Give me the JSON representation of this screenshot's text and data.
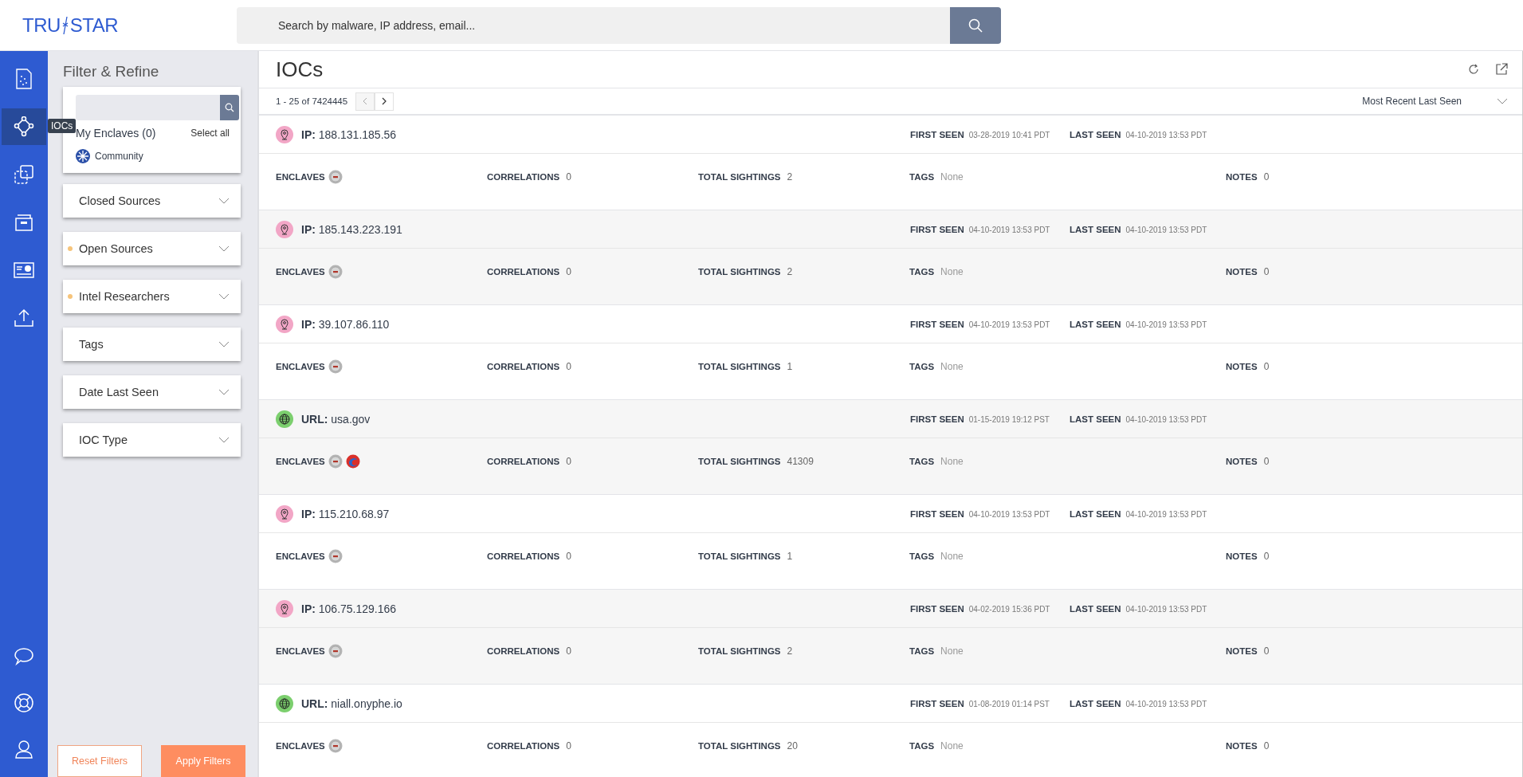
{
  "header": {
    "logo_left": "TRU",
    "logo_right": "STAR",
    "search": {
      "placeholder": "Search by malware, IP address, email..."
    }
  },
  "rail": {
    "items": [
      {
        "kind": "reports",
        "selected": false
      },
      {
        "kind": "network",
        "selected": true,
        "tooltip": "IOCs"
      },
      {
        "kind": "copy",
        "selected": false
      },
      {
        "kind": "archive",
        "selected": false
      },
      {
        "kind": "card",
        "selected": false
      },
      {
        "kind": "upload",
        "selected": false
      }
    ],
    "bottom": [
      {
        "kind": "chat"
      },
      {
        "kind": "help"
      },
      {
        "kind": "user"
      }
    ]
  },
  "filter": {
    "title": "Filter & Refine",
    "enclaves_label": "My Enclaves (0)",
    "select_all": "Select all",
    "community": "Community",
    "sections": [
      {
        "label": "Closed Sources",
        "indicator": false
      },
      {
        "label": "Open Sources",
        "indicator": true
      },
      {
        "label": "Intel Researchers",
        "indicator": true
      },
      {
        "label": "Tags",
        "indicator": false
      },
      {
        "label": "Date Last Seen",
        "indicator": false
      },
      {
        "label": "IOC Type",
        "indicator": false
      }
    ],
    "reset": "Reset Filters",
    "apply": "Apply Filters"
  },
  "main": {
    "title": "IOCs",
    "range": "1 - 25 of 7424445",
    "sort": "Most Recent Last Seen",
    "rows": [
      {
        "kind": "ip",
        "type_label": "IP:",
        "value": "188.131.185.56",
        "first_seen_label": "FIRST SEEN",
        "first_seen": "03-28-2019 10:41 PDT",
        "last_seen_label": "LAST SEEN",
        "last_seen": "04-10-2019 13:53 PDT",
        "enclaves_label": "ENCLAVES",
        "enclaves": [
          {
            "kind": "seal"
          }
        ],
        "correlations_label": "CORRELATIONS",
        "correlations": "0",
        "total_sightings_label": "TOTAL SIGHTINGS",
        "total_sightings": "2",
        "tags_label": "TAGS",
        "tags": "None",
        "notes_label": "NOTES",
        "notes": "0"
      },
      {
        "kind": "ip",
        "type_label": "IP:",
        "value": "185.143.223.191",
        "first_seen_label": "FIRST SEEN",
        "first_seen": "04-10-2019 13:53 PDT",
        "last_seen_label": "LAST SEEN",
        "last_seen": "04-10-2019 13:53 PDT",
        "enclaves_label": "ENCLAVES",
        "enclaves": [
          {
            "kind": "seal"
          }
        ],
        "correlations_label": "CORRELATIONS",
        "correlations": "0",
        "total_sightings_label": "TOTAL SIGHTINGS",
        "total_sightings": "2",
        "tags_label": "TAGS",
        "tags": "None",
        "notes_label": "NOTES",
        "notes": "0"
      },
      {
        "kind": "ip",
        "type_label": "IP:",
        "value": "39.107.86.110",
        "first_seen_label": "FIRST SEEN",
        "first_seen": "04-10-2019 13:53 PDT",
        "last_seen_label": "LAST SEEN",
        "last_seen": "04-10-2019 13:53 PDT",
        "enclaves_label": "ENCLAVES",
        "enclaves": [
          {
            "kind": "seal"
          }
        ],
        "correlations_label": "CORRELATIONS",
        "correlations": "0",
        "total_sightings_label": "TOTAL SIGHTINGS",
        "total_sightings": "1",
        "tags_label": "TAGS",
        "tags": "None",
        "notes_label": "NOTES",
        "notes": "0"
      },
      {
        "kind": "url",
        "type_label": "URL:",
        "value": "usa.gov",
        "first_seen_label": "FIRST SEEN",
        "first_seen": "01-15-2019 19:12 PST",
        "last_seen_label": "LAST SEEN",
        "last_seen": "04-10-2019 13:53 PDT",
        "enclaves_label": "ENCLAVES",
        "enclaves": [
          {
            "kind": "seal"
          },
          {
            "kind": "swirl"
          }
        ],
        "correlations_label": "CORRELATIONS",
        "correlations": "0",
        "total_sightings_label": "TOTAL SIGHTINGS",
        "total_sightings": "41309",
        "tags_label": "TAGS",
        "tags": "None",
        "notes_label": "NOTES",
        "notes": "0"
      },
      {
        "kind": "ip",
        "type_label": "IP:",
        "value": "115.210.68.97",
        "first_seen_label": "FIRST SEEN",
        "first_seen": "04-10-2019 13:53 PDT",
        "last_seen_label": "LAST SEEN",
        "last_seen": "04-10-2019 13:53 PDT",
        "enclaves_label": "ENCLAVES",
        "enclaves": [
          {
            "kind": "seal"
          }
        ],
        "correlations_label": "CORRELATIONS",
        "correlations": "0",
        "total_sightings_label": "TOTAL SIGHTINGS",
        "total_sightings": "1",
        "tags_label": "TAGS",
        "tags": "None",
        "notes_label": "NOTES",
        "notes": "0"
      },
      {
        "kind": "ip",
        "type_label": "IP:",
        "value": "106.75.129.166",
        "first_seen_label": "FIRST SEEN",
        "first_seen": "04-02-2019 15:36 PDT",
        "last_seen_label": "LAST SEEN",
        "last_seen": "04-10-2019 13:53 PDT",
        "enclaves_label": "ENCLAVES",
        "enclaves": [
          {
            "kind": "seal"
          }
        ],
        "correlations_label": "CORRELATIONS",
        "correlations": "0",
        "total_sightings_label": "TOTAL SIGHTINGS",
        "total_sightings": "2",
        "tags_label": "TAGS",
        "tags": "None",
        "notes_label": "NOTES",
        "notes": "0"
      },
      {
        "kind": "url",
        "type_label": "URL:",
        "value": "niall.onyphe.io",
        "first_seen_label": "FIRST SEEN",
        "first_seen": "01-08-2019 01:14 PST",
        "last_seen_label": "LAST SEEN",
        "last_seen": "04-10-2019 13:53 PDT",
        "enclaves_label": "ENCLAVES",
        "enclaves": [
          {
            "kind": "seal"
          }
        ],
        "correlations_label": "CORRELATIONS",
        "correlations": "0",
        "total_sightings_label": "TOTAL SIGHTINGS",
        "total_sightings": "20",
        "tags_label": "TAGS",
        "tags": "None",
        "notes_label": "NOTES",
        "notes": "0"
      }
    ]
  }
}
